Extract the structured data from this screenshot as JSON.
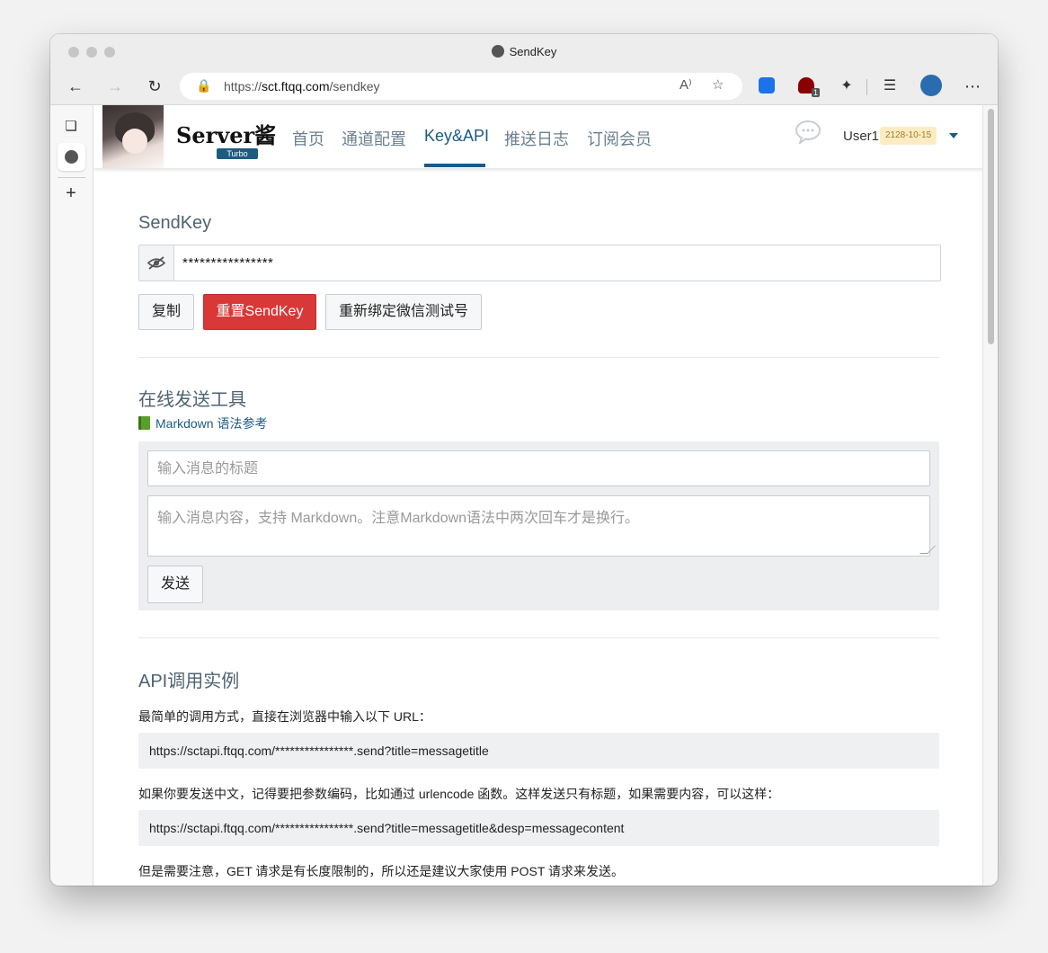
{
  "window": {
    "title": "SendKey"
  },
  "browser": {
    "url_prefix": "https://",
    "url_host": "sct.ftqq.com",
    "url_path": "/sendkey",
    "ext_badge": "1"
  },
  "nav": {
    "brand": "Server酱",
    "badge": "Turbo",
    "links": [
      "首页",
      "通道配置",
      "Key&API",
      "推送日志",
      "订阅会员"
    ],
    "user": "User1",
    "expiry": "2128-10-15"
  },
  "sendkey": {
    "title": "SendKey",
    "masked_value": "****************",
    "copy_label": "复制",
    "reset_label": "重置SendKey",
    "rebind_label": "重新绑定微信测试号"
  },
  "online_tool": {
    "title": "在线发送工具",
    "md_link": "Markdown 语法参考",
    "title_placeholder": "输入消息的标题",
    "content_placeholder": "输入消息内容，支持 Markdown。注意Markdown语法中两次回车才是换行。",
    "send_label": "发送"
  },
  "api": {
    "title": "API调用实例",
    "p1": "最简单的调用方式，直接在浏览器中输入以下 URL：",
    "url1": "https://sctapi.ftqq.com/****************.send?title=messagetitle",
    "p2": "如果你要发送中文，记得要把参数编码，比如通过 urlencode 函数。这样发送只有标题，如果需要内容，可以这样：",
    "url2": "https://sctapi.ftqq.com/****************.send?title=messagetitle&desp=messagecontent",
    "p3": "但是需要注意，GET 请求是有长度限制的，所以还是建议大家使用 POST 请求来发送。"
  }
}
